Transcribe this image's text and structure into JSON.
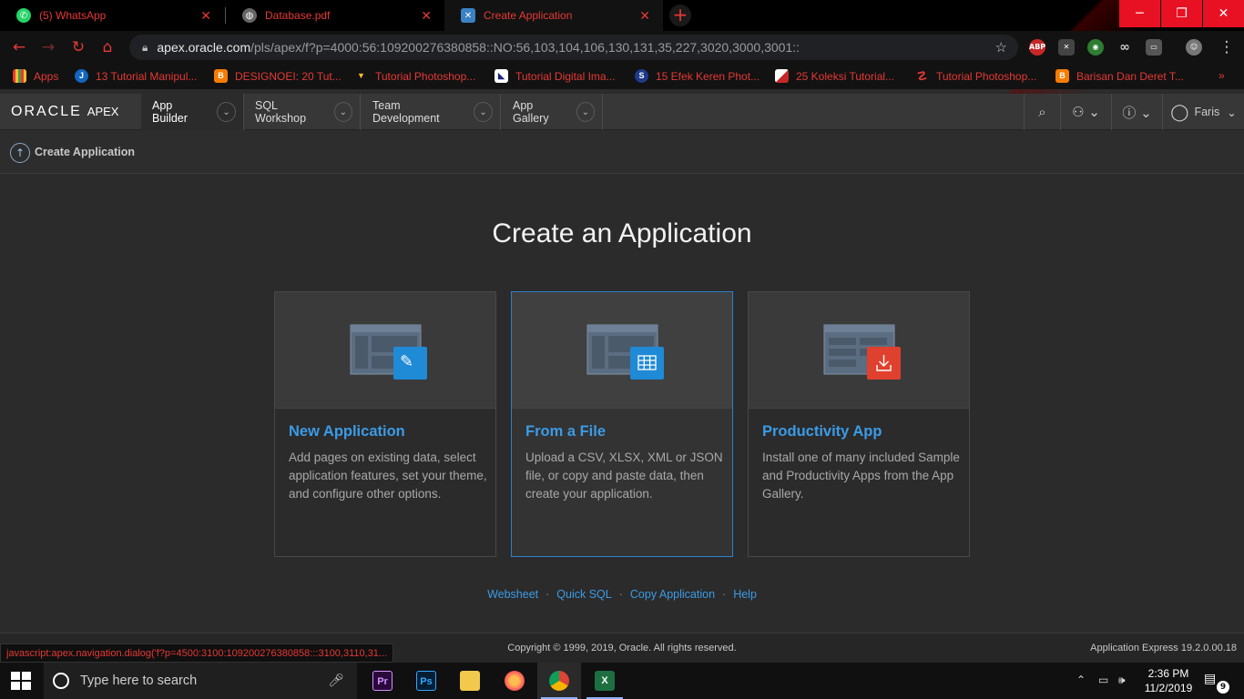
{
  "browser": {
    "tabs": [
      {
        "title": "(5) WhatsApp",
        "icon": "whatsapp-icon"
      },
      {
        "title": "Database.pdf",
        "icon": "globe-icon"
      },
      {
        "title": "Create Application",
        "icon": "apex-icon"
      }
    ],
    "url_host": "apex.oracle.com",
    "url_path": "/pls/apex/f?p=4000:56:109200276380858::NO:56,103,104,106,130,131,35,227,3020,3000,3001::",
    "extensions": [
      "ABP"
    ],
    "bookmarks": [
      {
        "label": "Apps",
        "icon": "apps-grid-icon"
      },
      {
        "label": "13 Tutorial Manipul...",
        "icon": "j-icon"
      },
      {
        "label": "DESIGNOEI: 20 Tut...",
        "icon": "blogger-icon"
      },
      {
        "label": "Tutorial Photoshop...",
        "icon": "v-logo-icon"
      },
      {
        "label": "Tutorial Digital Ima...",
        "icon": "site-icon"
      },
      {
        "label": "15 Efek Keren Phot...",
        "icon": "s-icon"
      },
      {
        "label": "25 Koleksi Tutorial...",
        "icon": "flag-icon"
      },
      {
        "label": "Tutorial Photoshop...",
        "icon": "wifi-icon"
      },
      {
        "label": "Barisan Dan Deret T...",
        "icon": "blogger-icon"
      }
    ]
  },
  "apex": {
    "logo_oracle": "ORACLE",
    "logo_apex": "APEX",
    "nav": [
      "App Builder",
      "SQL Workshop",
      "Team Development",
      "App Gallery"
    ],
    "user": "Faris",
    "breadcrumb": "Create Application",
    "page_title": "Create an Application",
    "cards": [
      {
        "title": "New Application",
        "description": "Add pages on existing data, select application features, set your theme, and configure other options.",
        "badge_icon": "wrench-pencil-icon"
      },
      {
        "title": "From a File",
        "description": "Upload a CSV, XLSX, XML or JSON file, or copy and paste data, then create your application.",
        "badge_icon": "table-icon"
      },
      {
        "title": "Productivity App",
        "description": "Install one of many included Sample and Productivity Apps from the App Gallery.",
        "badge_icon": "download-icon"
      }
    ],
    "links": [
      "Websheet",
      "Quick SQL",
      "Copy Application",
      "Help"
    ],
    "copyright": "Copyright © 1999, 2019, Oracle. All rights reserved.",
    "version": "Application Express 19.2.0.00.18",
    "status_link": "javascript:apex.navigation.dialog('f?p=4500:3100:109200276380858:::3100,3110,31..."
  },
  "taskbar": {
    "search_placeholder": "Type here to search",
    "time": "2:36 PM",
    "date": "11/2/2019",
    "notification_count": "9"
  },
  "colors": {
    "accent_blue": "#3b9be6",
    "browser_red": "#e53935",
    "badge_blue": "#1f8ad6",
    "badge_red": "#e0402e"
  }
}
